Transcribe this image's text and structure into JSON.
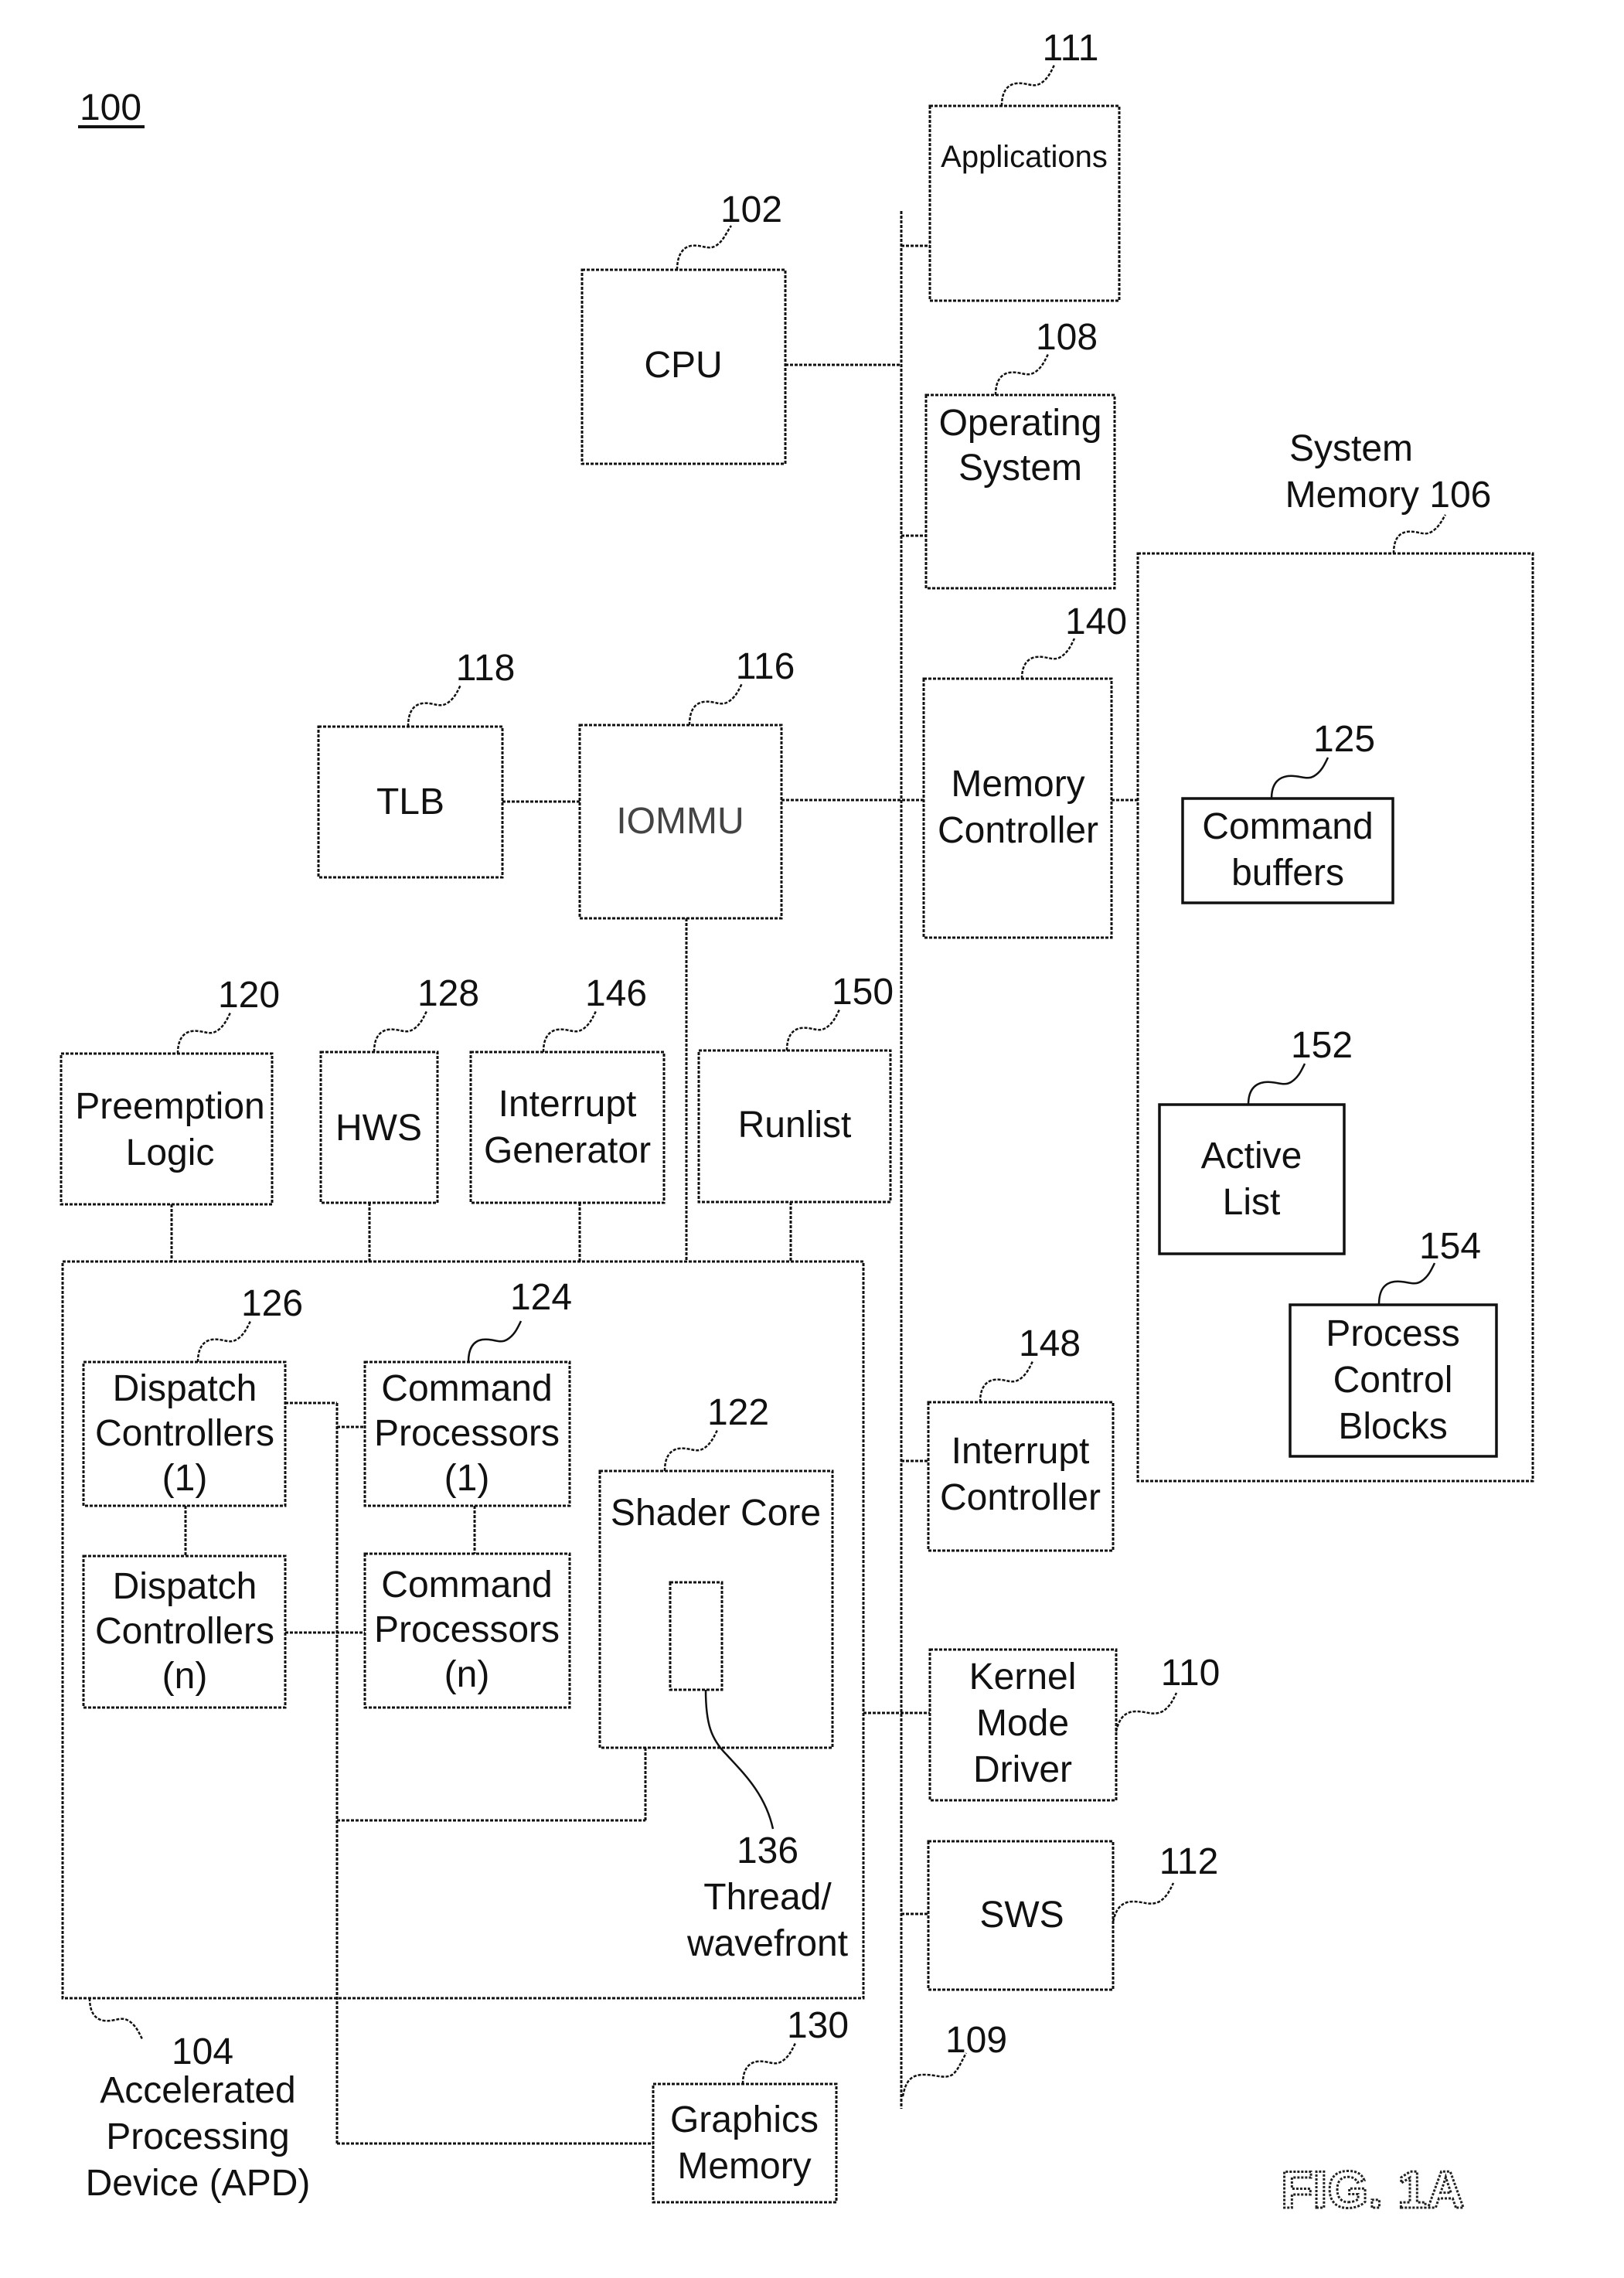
{
  "figure": {
    "reference": "100",
    "caption": "FIG. 1A"
  },
  "bus": {
    "ref": "109"
  },
  "components": {
    "applications": {
      "ref": "111",
      "lines": [
        "Applications"
      ]
    },
    "cpu": {
      "ref": "102",
      "lines": [
        "CPU"
      ]
    },
    "operating_system": {
      "ref": "108",
      "lines": [
        "Operating",
        "System"
      ]
    },
    "system_memory": {
      "ref_lines": [
        "System",
        "Memory 106"
      ]
    },
    "memory_controller": {
      "ref": "140",
      "lines": [
        "Memory",
        "Controller"
      ]
    },
    "command_buffers": {
      "ref": "125",
      "lines": [
        "Command",
        "buffers"
      ]
    },
    "active_list": {
      "ref": "152",
      "lines": [
        "Active",
        "List"
      ]
    },
    "process_control_blocks": {
      "ref": "154",
      "lines": [
        "Process",
        "Control",
        "Blocks"
      ]
    },
    "tlb": {
      "ref": "118",
      "lines": [
        "TLB"
      ]
    },
    "iommu": {
      "ref": "116",
      "lines": [
        "IOMMU"
      ]
    },
    "preemption_logic": {
      "ref": "120",
      "lines": [
        "Preemption",
        "Logic"
      ]
    },
    "hws": {
      "ref": "128",
      "lines": [
        "HWS"
      ]
    },
    "interrupt_generator": {
      "ref": "146",
      "lines": [
        "Interrupt",
        "Generator"
      ]
    },
    "runlist": {
      "ref": "150",
      "lines": [
        "Runlist"
      ]
    },
    "dispatch_controllers_1": {
      "ref": "126",
      "lines": [
        "Dispatch",
        "Controllers",
        "(1)"
      ]
    },
    "dispatch_controllers_n": {
      "lines": [
        "Dispatch",
        "Controllers",
        "(n)"
      ]
    },
    "command_processors_1": {
      "ref": "124",
      "lines": [
        "Command",
        "Processors",
        "(1)"
      ]
    },
    "command_processors_n": {
      "lines": [
        "Command",
        "Processors",
        "(n)"
      ]
    },
    "shader_core": {
      "ref": "122",
      "lines": [
        "Shader Core"
      ]
    },
    "thread_wavefront": {
      "ref": "136",
      "lines": [
        "Thread/",
        "wavefront"
      ]
    },
    "interrupt_controller": {
      "ref": "148",
      "lines": [
        "Interrupt",
        "Controller"
      ]
    },
    "kernel_mode_driver": {
      "ref": "110",
      "lines": [
        "Kernel",
        "Mode",
        "Driver"
      ]
    },
    "sws": {
      "ref": "112",
      "lines": [
        "SWS"
      ]
    },
    "graphics_memory": {
      "ref": "130",
      "lines": [
        "Graphics",
        "Memory"
      ]
    },
    "apd": {
      "ref": "104",
      "lines": [
        "Accelerated",
        "Processing",
        "Device (APD)"
      ]
    }
  }
}
